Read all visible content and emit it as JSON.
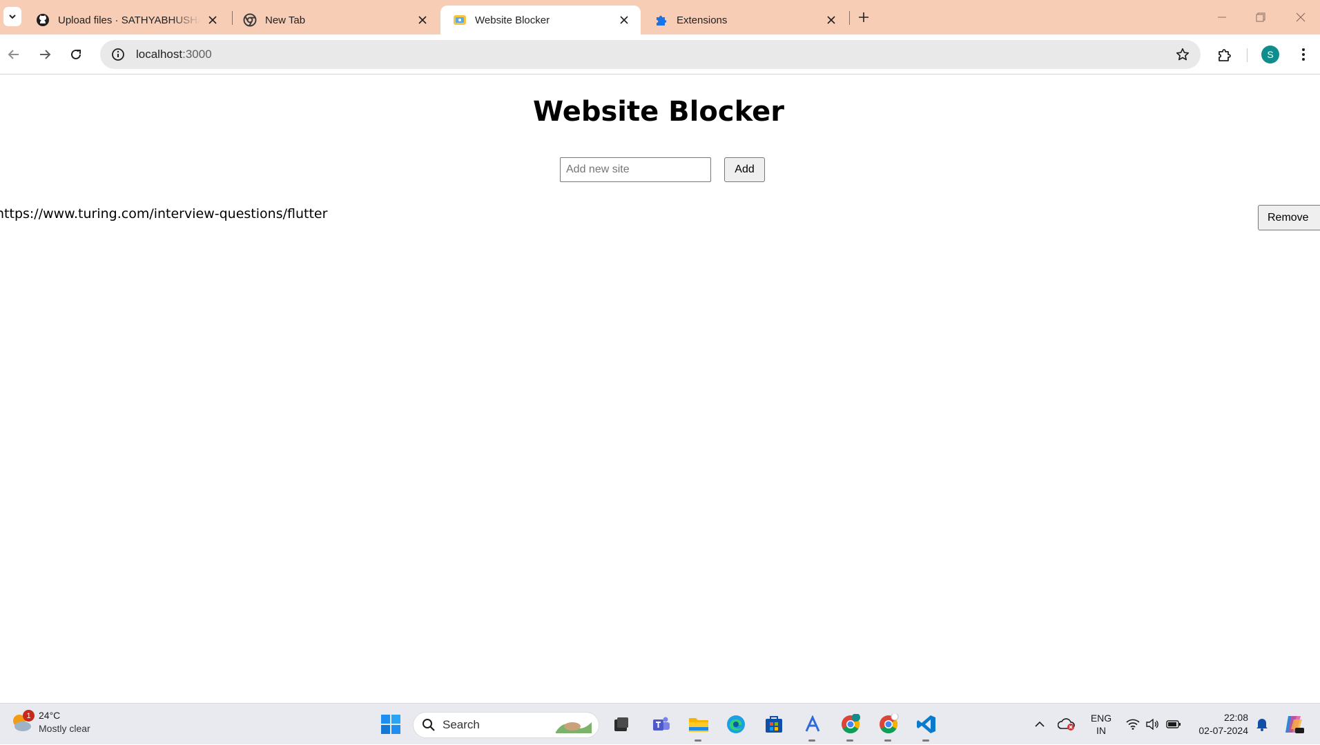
{
  "browser": {
    "tabs": [
      {
        "title": "Upload files · SATHYABHUSHAN",
        "favicon": "github-icon",
        "active": false
      },
      {
        "title": "New Tab",
        "favicon": "chrome-icon",
        "active": false
      },
      {
        "title": "Website Blocker",
        "favicon": "react-app-icon",
        "active": true
      },
      {
        "title": "Extensions",
        "favicon": "puzzle-icon",
        "active": false
      }
    ],
    "address": {
      "host": "localhost",
      "port": ":3000"
    },
    "profile_initial": "S",
    "colors": {
      "tabstrip": "#f8cdb6",
      "omnibox": "#e9e9e9",
      "avatar": "#0f8d8d"
    }
  },
  "app": {
    "title": "Website Blocker",
    "input_placeholder": "Add new site",
    "input_value": "",
    "add_label": "Add",
    "sites": [
      {
        "url": "https://www.turing.com/interview-questions/flutter",
        "remove_label": "Remove"
      }
    ]
  },
  "taskbar": {
    "weather": {
      "temp": "24°C",
      "condition": "Mostly clear",
      "badge": "1"
    },
    "search_label": "Search",
    "lang_line1": "ENG",
    "lang_line2": "IN",
    "time": "22:08",
    "date": "02-07-2024"
  }
}
